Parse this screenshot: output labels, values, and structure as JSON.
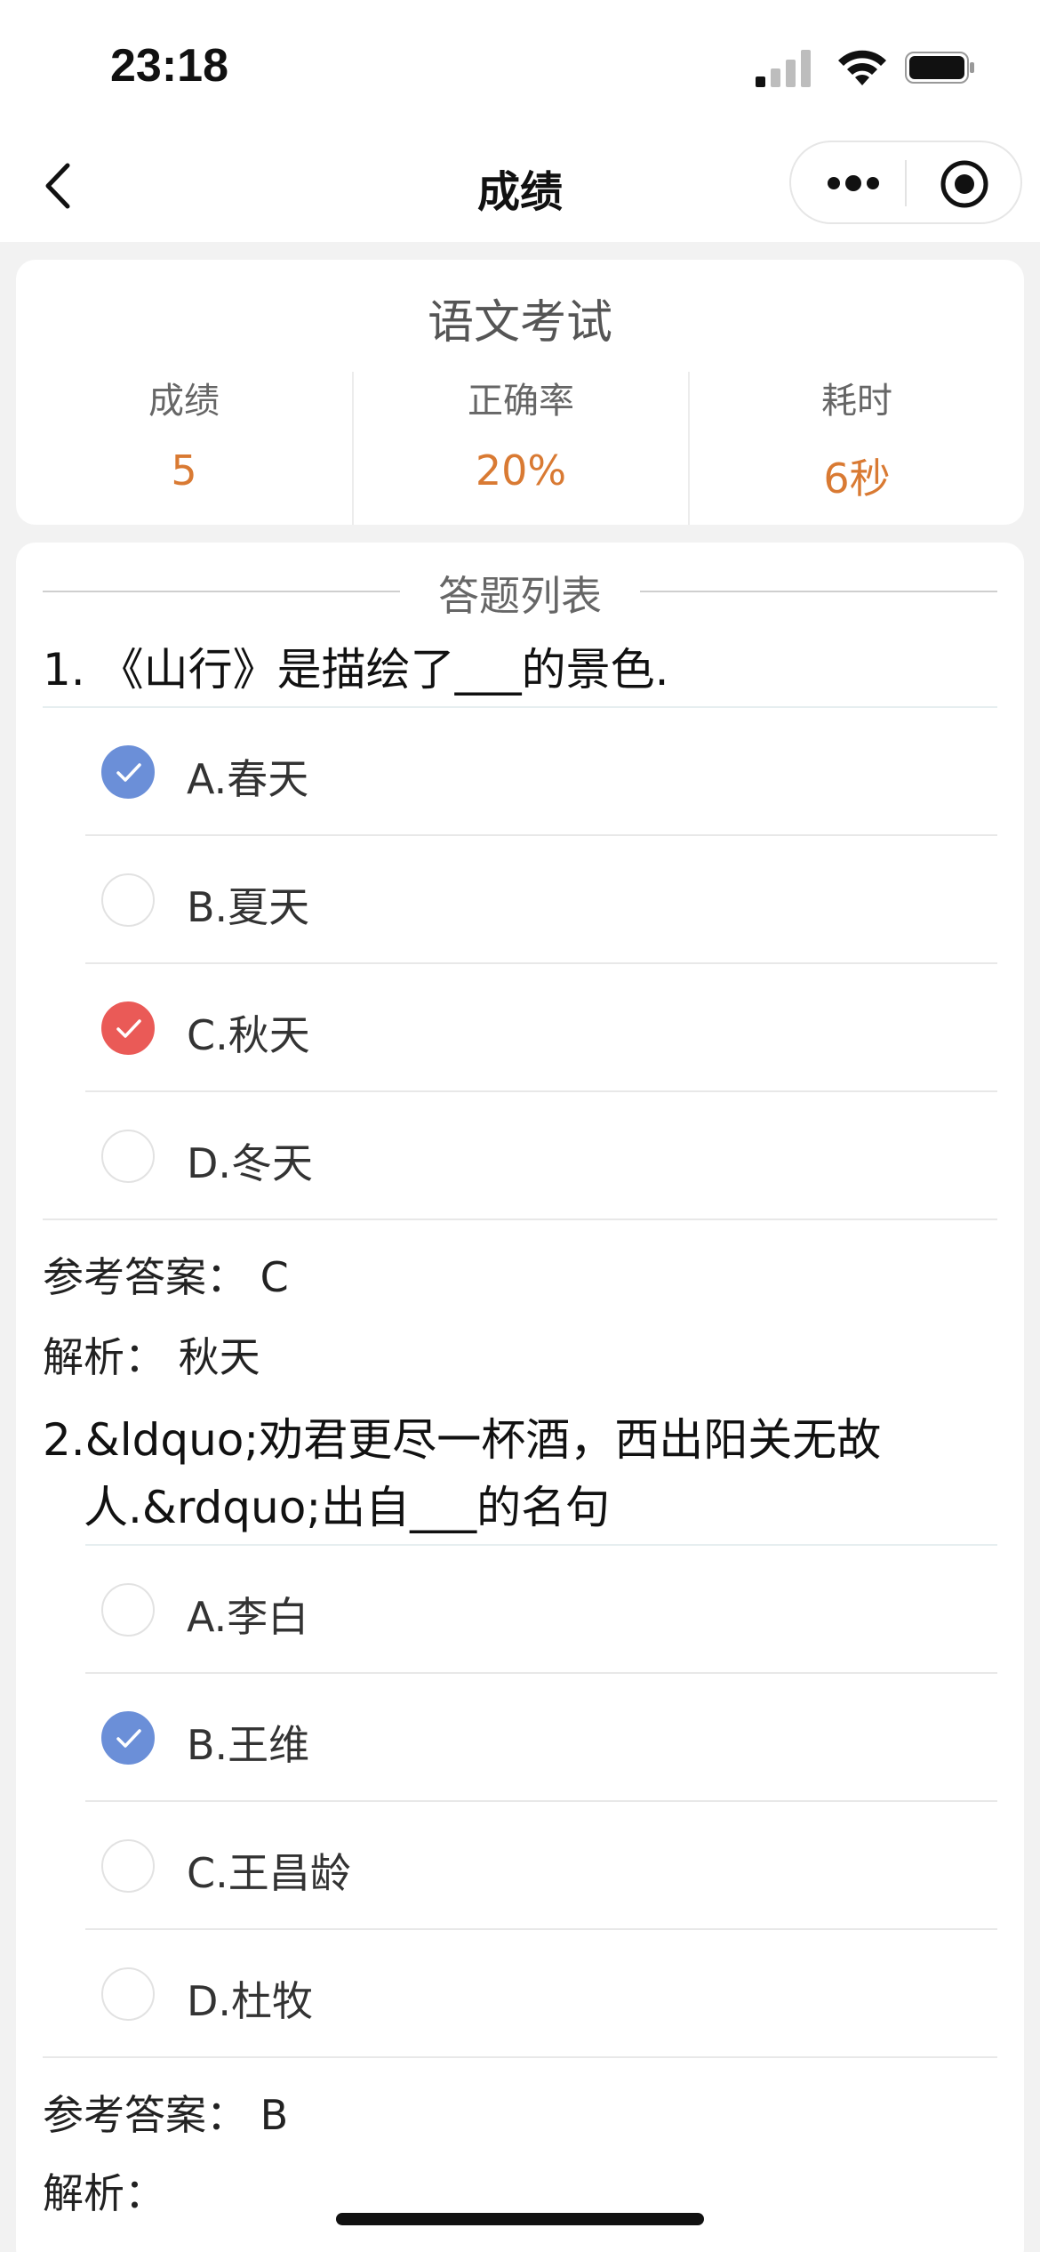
{
  "status_bar": {
    "time": "23:18",
    "icons": [
      "signal-icon",
      "wifi-icon",
      "battery-icon"
    ]
  },
  "nav": {
    "title": "成绩",
    "icons": [
      "back-icon",
      "more-icon",
      "target-icon"
    ]
  },
  "summary": {
    "exam_title": "语文考试",
    "stats": [
      {
        "label": "成绩",
        "value": "5"
      },
      {
        "label": "正确率",
        "value": "20%"
      },
      {
        "label": "耗时",
        "value": "6秒"
      }
    ]
  },
  "list": {
    "header": "答题列表",
    "questions": [
      {
        "text": "1. 《山行》是描绘了___的景色.",
        "options": [
          {
            "label": "A.春天",
            "state": "selected-blue"
          },
          {
            "label": "B.夏天",
            "state": "empty"
          },
          {
            "label": "C.秋天",
            "state": "correct-red"
          },
          {
            "label": "D.冬天",
            "state": "empty"
          }
        ],
        "answer": "参考答案： C",
        "analysis": "解析： 秋天"
      },
      {
        "text_line1": "2.&ldquo;劝君更尽一杯酒，西出阳关无故",
        "text_line2": "人.&rdquo;出自___的名句",
        "options": [
          {
            "label": "A.李白",
            "state": "empty"
          },
          {
            "label": "B.王维",
            "state": "selected-blue"
          },
          {
            "label": "C.王昌龄",
            "state": "empty"
          },
          {
            "label": "D.杜牧",
            "state": "empty"
          }
        ],
        "answer": "参考答案： B",
        "analysis": "解析："
      }
    ]
  },
  "colors": {
    "accent_orange": "#d97a33",
    "selected_blue": "#6b8fd8",
    "correct_red": "#ea5a57"
  }
}
